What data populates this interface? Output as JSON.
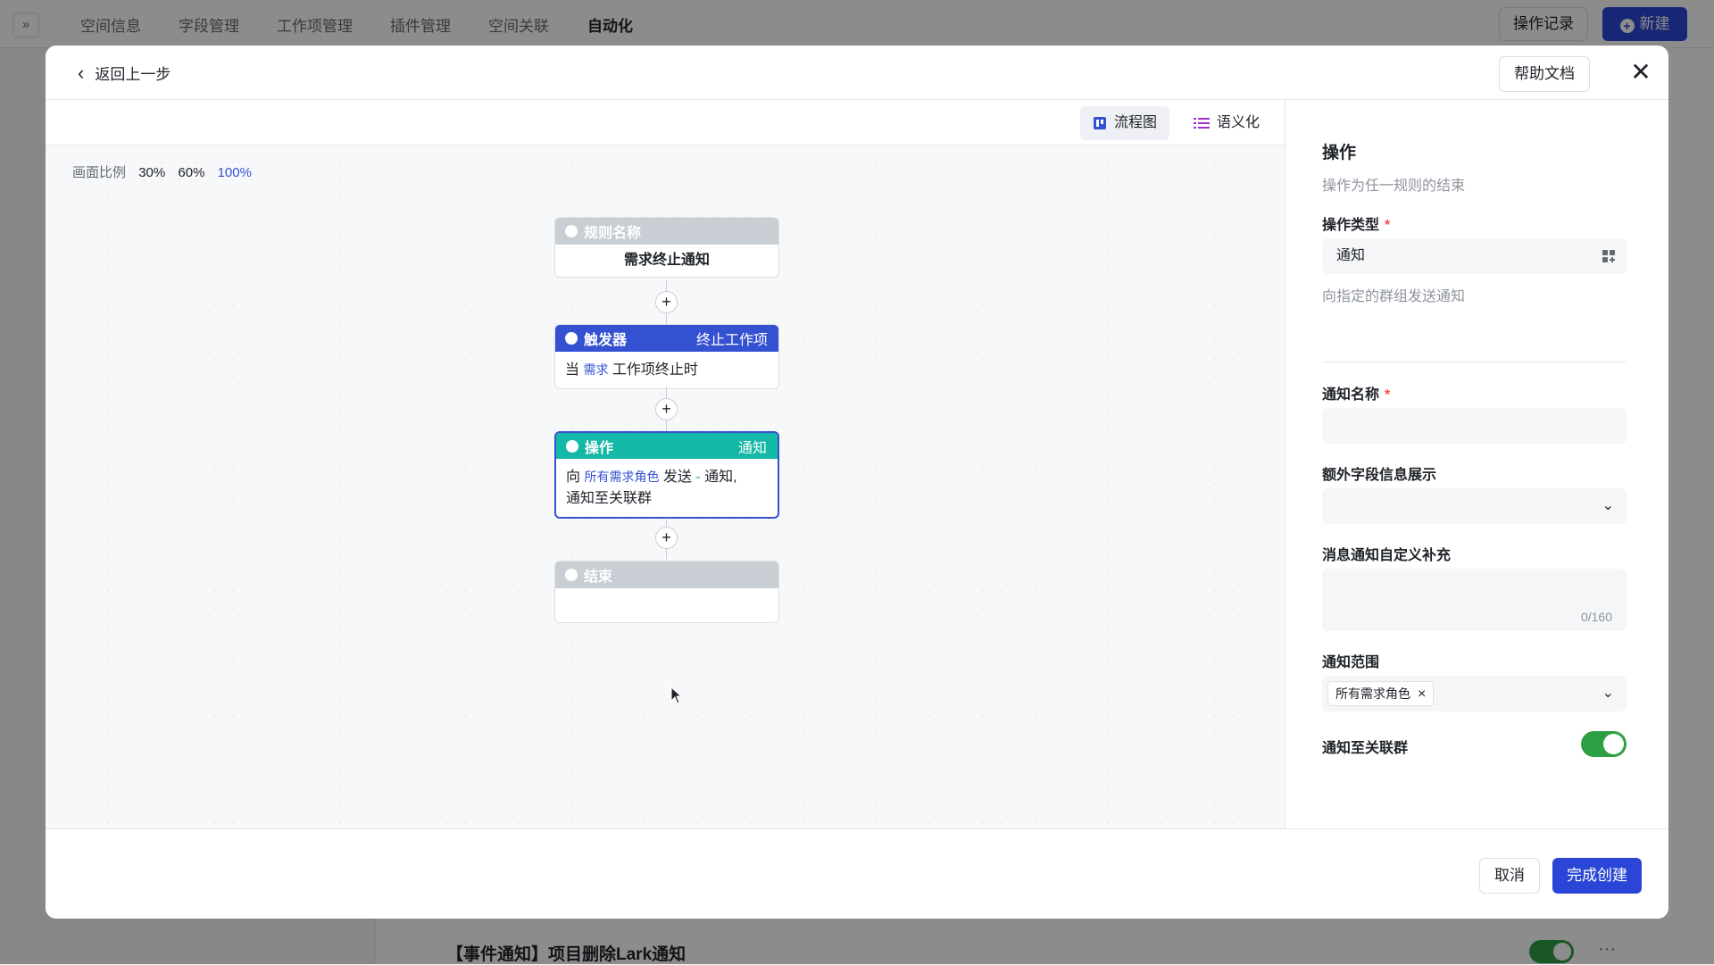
{
  "background": {
    "nav_tabs": [
      "空间信息",
      "字段管理",
      "工作项管理",
      "插件管理",
      "空间关联",
      "自动化"
    ],
    "active_tab": "自动化",
    "log_button": "操作记录",
    "new_button": "新建",
    "row_title": "【事件通知】项目删除Lark通知",
    "row_more": "···"
  },
  "modal": {
    "back_label": "返回上一步",
    "help_label": "帮助文档",
    "close_glyph": "✕",
    "view_modes": {
      "flow": "流程图",
      "semantic": "语义化"
    },
    "zoom": {
      "label": "画面比例",
      "options": [
        "30%",
        "60%",
        "100%"
      ],
      "active": "100%"
    },
    "nodes": {
      "rule": {
        "header": "规则名称",
        "body": "需求终止通知"
      },
      "trigger": {
        "header": "触发器",
        "header_right": "终止工作项",
        "pre": "当 ",
        "entity": "需求",
        "post": " 工作项终止时"
      },
      "action": {
        "header": "操作",
        "header_right": "通知",
        "pre": "向 ",
        "target": "所有需求角色",
        "mid": " 发送 ",
        "dash": "-",
        "post1": " 通知,",
        "line2": "通知至关联群"
      },
      "end": {
        "header": "结束"
      }
    },
    "panel": {
      "title": "操作",
      "subtitle": "操作为任一规则的结束",
      "action_type_label": "操作类型",
      "action_type_value": "通知",
      "action_type_help": "向指定的群组发送通知",
      "notify_name_label": "通知名称",
      "notify_name_value": "",
      "extra_fields_label": "额外字段信息展示",
      "custom_supplement_label": "消息通知自定义补充",
      "custom_supplement_counter": "0/160",
      "scope_label": "通知范围",
      "scope_tag": "所有需求角色",
      "group_label": "通知至关联群",
      "group_enabled": true,
      "required_mark": "*"
    },
    "footer": {
      "cancel": "取消",
      "finish": "完成创建"
    }
  },
  "colors": {
    "primary": "#2b45d6",
    "teal": "#14b8a6",
    "toggle_on": "#2ea043",
    "required": "#f54a45"
  }
}
